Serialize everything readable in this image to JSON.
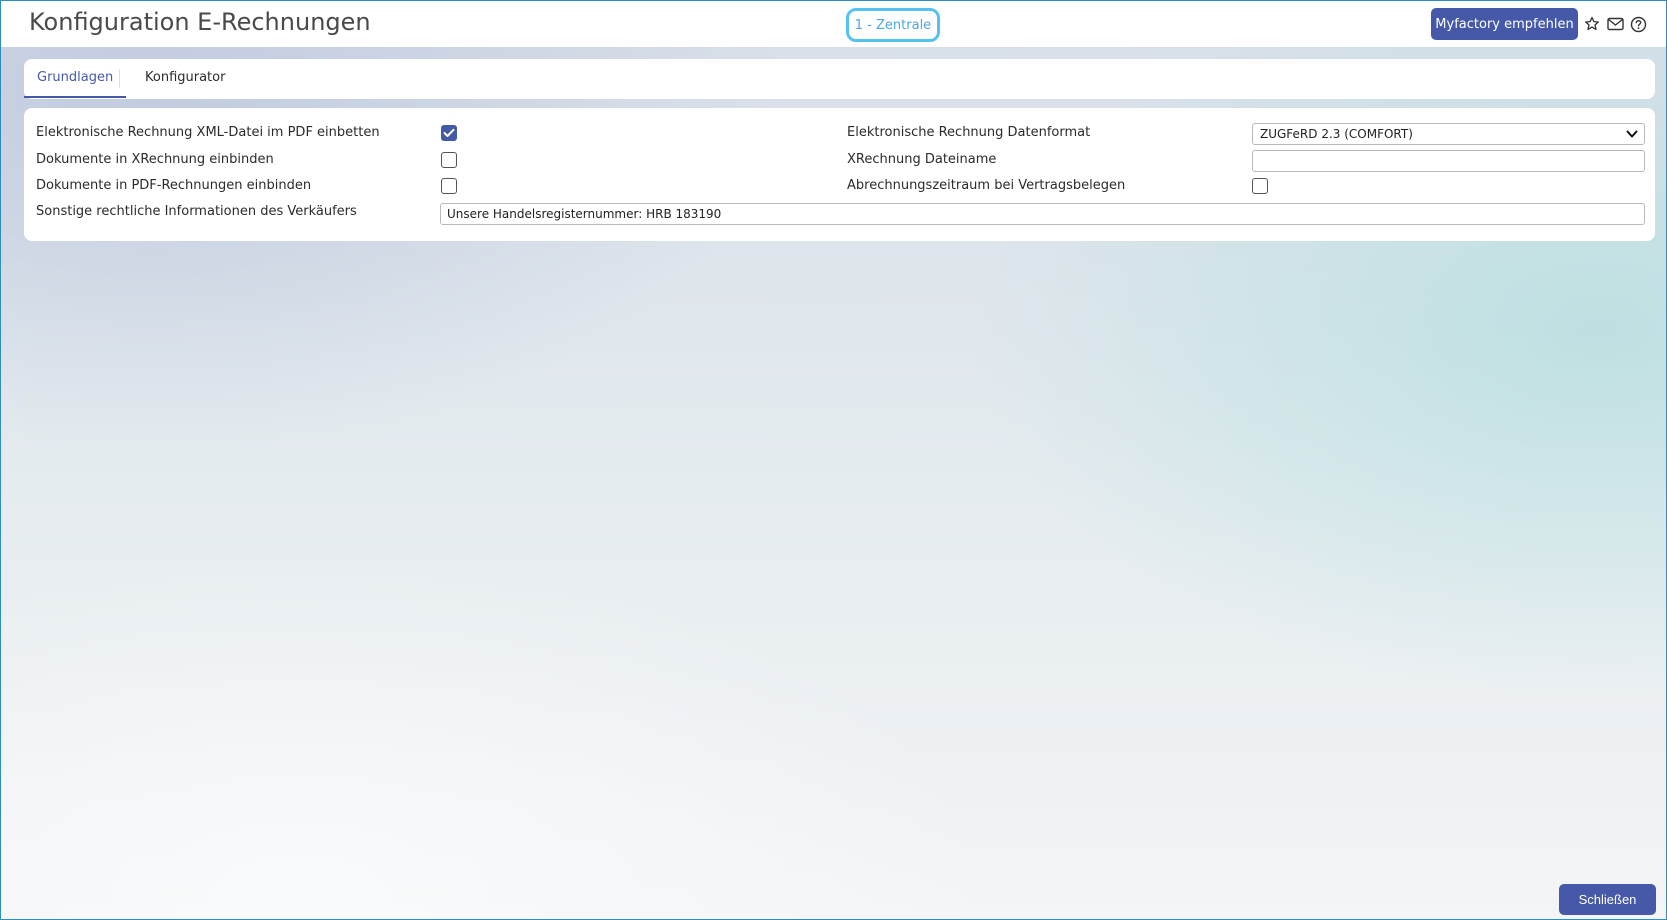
{
  "header": {
    "title": "Konfiguration E-Rechnungen",
    "client_badge": "1 - Zentrale",
    "recommend_button": "Myfactory empfehlen",
    "icons": [
      "star-icon",
      "mail-icon",
      "help-icon"
    ]
  },
  "tabs": [
    {
      "label": "Grundlagen",
      "active": true
    },
    {
      "label": "Konfigurator",
      "active": false
    }
  ],
  "form": {
    "left": [
      {
        "label": "Elektronische Rechnung XML-Datei im PDF einbetten",
        "checked": true
      },
      {
        "label": "Dokumente in XRechnung einbinden",
        "checked": false
      },
      {
        "label": "Dokumente in PDF-Rechnungen einbinden",
        "checked": false
      }
    ],
    "right": {
      "format_label": "Elektronische Rechnung Datenformat",
      "format_value": "ZUGFeRD 2.3 (COMFORT)",
      "filename_label": "XRechnung Dateiname",
      "filename_value": "",
      "period_label": "Abrechnungszeitraum bei Vertragsbelegen",
      "period_checked": false
    },
    "seller_info_label": "Sonstige rechtliche Informationen des Verkäufers",
    "seller_info_value": "Unsere Handelsregisternummer: HRB 183190"
  },
  "footer": {
    "close_button": "Schließen"
  },
  "colors": {
    "accent": "#4659a8",
    "badge_border": "#55c2f2",
    "window_border": "#2f8dc4"
  }
}
